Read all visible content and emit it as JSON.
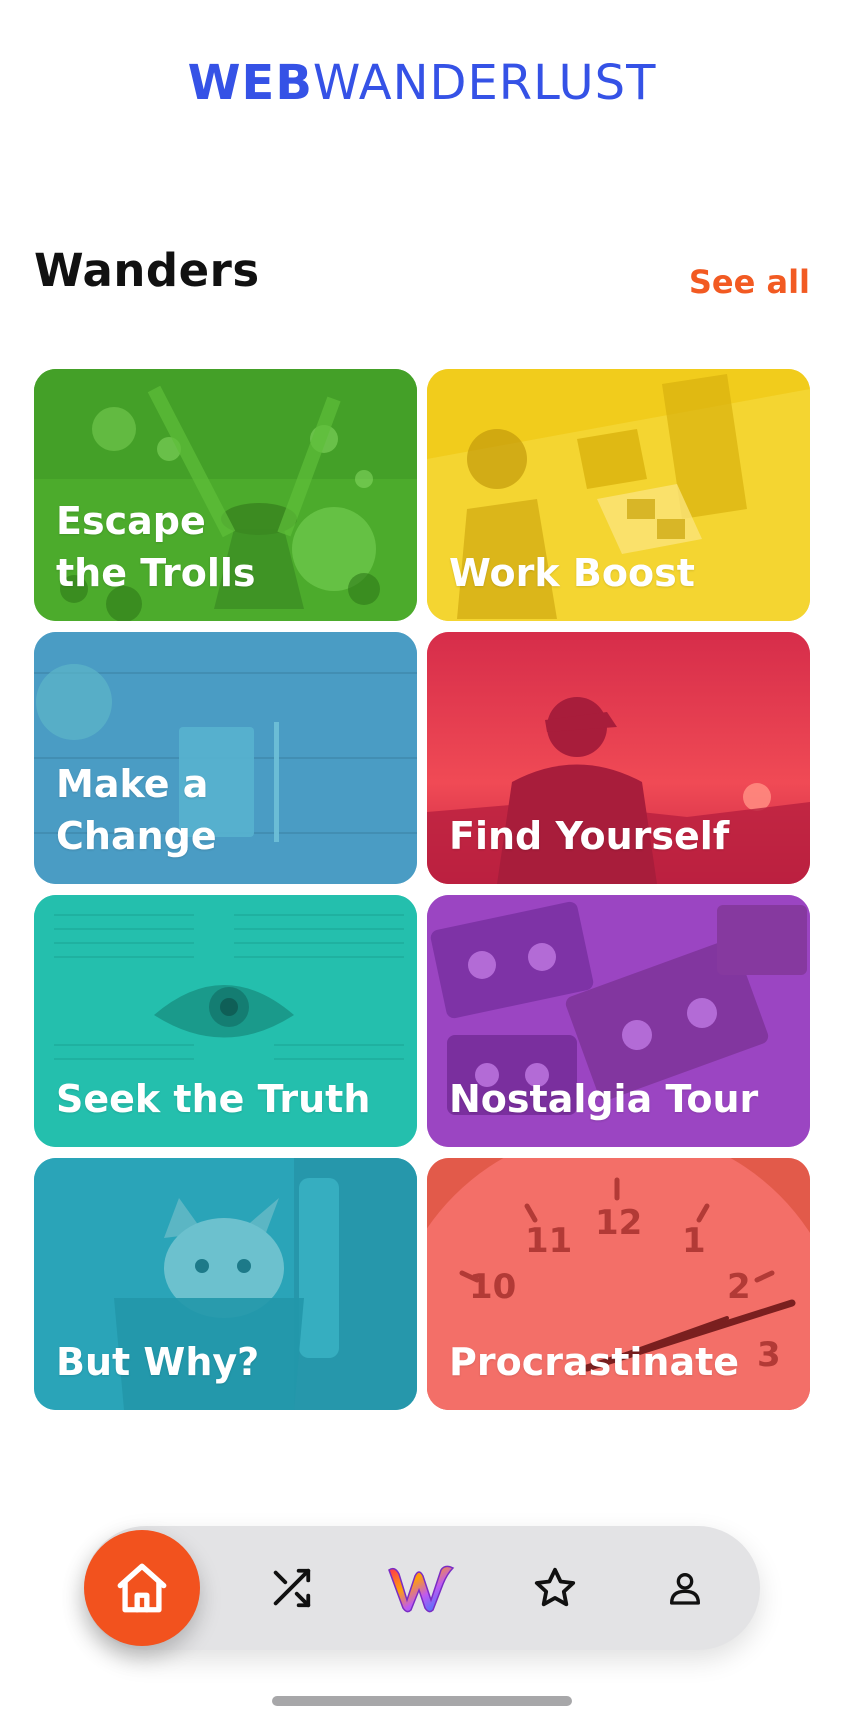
{
  "brand": {
    "bold": "WEB",
    "light": "WANDERLUST",
    "color": "#3552e6"
  },
  "section": {
    "title": "Wanders",
    "see_all": "See all",
    "accent": "#f25a22"
  },
  "cards": [
    {
      "label": "Escape the Trolls",
      "line1": "Escape",
      "line2": "the Trolls",
      "color": "#4cab2c"
    },
    {
      "label": "Work Boost",
      "line1": "Work Boost",
      "line2": "",
      "color": "#f1cc1c"
    },
    {
      "label": "Make a Change",
      "line1": "Make a",
      "line2": "Change",
      "color": "#4a9cc4"
    },
    {
      "label": "Find Yourself",
      "line1": "Find Yourself",
      "line2": "",
      "color": "#e4354f"
    },
    {
      "label": "Seek the Truth",
      "line1": "Seek the Truth",
      "line2": "",
      "color": "#24bfad"
    },
    {
      "label": "Nostalgia Tour",
      "line1": "Nostalgia Tour",
      "line2": "",
      "color": "#9b45c2"
    },
    {
      "label": "But Why?",
      "line1": "But Why?",
      "line2": "",
      "color": "#2aa4b8"
    },
    {
      "label": "Procrastinate",
      "line1": "Procrastinate",
      "line2": "",
      "color": "#f06b64"
    }
  ],
  "bottom_nav": {
    "items": [
      "home-icon",
      "shuffle-icon",
      "app-logo-icon",
      "star-icon",
      "profile-icon"
    ],
    "active": "home-icon",
    "active_color": "#f2521e"
  }
}
